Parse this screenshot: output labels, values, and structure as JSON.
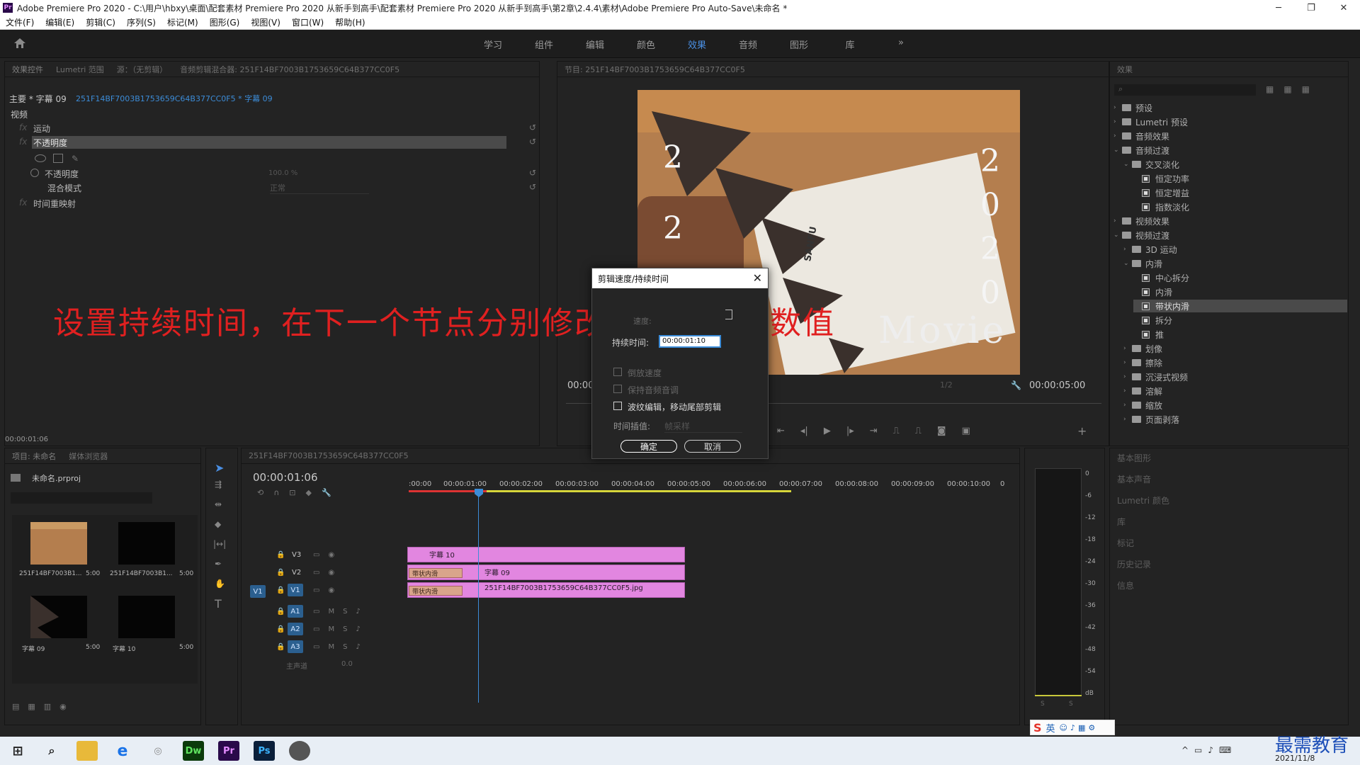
{
  "window": {
    "title": "Adobe Premiere Pro 2020 - C:\\用户\\hbxy\\桌面\\配套素材 Premiere Pro 2020 从新手到高手\\配套素材 Premiere Pro 2020 从新手到高手\\第2章\\2.4.4\\素材\\Adobe Premiere Pro Auto-Save\\未命名 *",
    "minimize": "─",
    "restore": "❐",
    "close": "✕"
  },
  "menu": [
    "文件(F)",
    "编辑(E)",
    "剪辑(C)",
    "序列(S)",
    "标记(M)",
    "图形(G)",
    "视图(V)",
    "窗口(W)",
    "帮助(H)"
  ],
  "workspaces": {
    "tabs": [
      "学习",
      "组件",
      "编辑",
      "颜色",
      "效果",
      "音频",
      "图形",
      "库"
    ],
    "active": "效果",
    "more": "»"
  },
  "effect_controls": {
    "tabs": [
      "效果控件",
      "Lumetri 范围",
      "源：（无剪辑）",
      "音频剪辑混合器: 251F14BF7003B1753659C64B377CC0F5"
    ],
    "master": "主要 * 字幕 09",
    "clip": "251F14BF7003B1753659C64B377CC0F5 * 字幕 09",
    "section": "视频",
    "motion": "运动",
    "opacity": "不透明度",
    "opacity_param": "不透明度",
    "opacity_value": "100.0 %",
    "blend_label": "混合模式",
    "blend_value": "正常",
    "time_remap": "时间重映射",
    "timecode": "00:00:01:06",
    "fx_glyph": "fx"
  },
  "program_monitor": {
    "title": "节目: 251F14BF7003B1753659C64B377CC0F5",
    "timecode_left": "00:00",
    "timecode_right": "00:00:05:00",
    "fraction": "1/2",
    "overlay_digits_left": "2",
    "overlay_digits_left2": "2",
    "overlay_digits_right": [
      "2",
      "0",
      "2",
      "0"
    ],
    "overlay_title": "Movie",
    "box_text": "SANFU"
  },
  "effects_panel": {
    "title": "效果",
    "items": [
      {
        "label": "预设",
        "level": 0,
        "kind": "folder",
        "open": false
      },
      {
        "label": "Lumetri 预设",
        "level": 0,
        "kind": "folder",
        "open": false
      },
      {
        "label": "音频效果",
        "level": 0,
        "kind": "folder",
        "open": false
      },
      {
        "label": "音频过渡",
        "level": 0,
        "kind": "folder",
        "open": true
      },
      {
        "label": "交叉淡化",
        "level": 1,
        "kind": "folder",
        "open": true
      },
      {
        "label": "恒定功率",
        "level": 2,
        "kind": "fx"
      },
      {
        "label": "恒定增益",
        "level": 2,
        "kind": "fx"
      },
      {
        "label": "指数淡化",
        "level": 2,
        "kind": "fx"
      },
      {
        "label": "视频效果",
        "level": 0,
        "kind": "folder",
        "open": false
      },
      {
        "label": "视频过渡",
        "level": 0,
        "kind": "folder",
        "open": true
      },
      {
        "label": "3D 运动",
        "level": 1,
        "kind": "folder",
        "open": false
      },
      {
        "label": "内滑",
        "level": 1,
        "kind": "folder",
        "open": true
      },
      {
        "label": "中心拆分",
        "level": 2,
        "kind": "fx"
      },
      {
        "label": "内滑",
        "level": 2,
        "kind": "fx"
      },
      {
        "label": "带状内滑",
        "level": 2,
        "kind": "fx",
        "selected": true
      },
      {
        "label": "拆分",
        "level": 2,
        "kind": "fx"
      },
      {
        "label": "推",
        "level": 2,
        "kind": "fx"
      },
      {
        "label": "划像",
        "level": 1,
        "kind": "folder",
        "open": false
      },
      {
        "label": "擦除",
        "level": 1,
        "kind": "folder",
        "open": false
      },
      {
        "label": "沉浸式视频",
        "level": 1,
        "kind": "folder",
        "open": false
      },
      {
        "label": "溶解",
        "level": 1,
        "kind": "folder",
        "open": false
      },
      {
        "label": "缩放",
        "level": 1,
        "kind": "folder",
        "open": false
      },
      {
        "label": "页面剥落",
        "level": 1,
        "kind": "folder",
        "open": false
      }
    ]
  },
  "side_panels": [
    "基本图形",
    "基本声音",
    "Lumetri 颜色",
    "库",
    "标记",
    "历史记录",
    "信息"
  ],
  "project": {
    "tabs": [
      "项目: 未命名",
      "媒体浏览器"
    ],
    "file": "未命名.prproj",
    "items": [
      {
        "name": "251F14BF7003B1...",
        "dur": "5:00",
        "kind": "photo"
      },
      {
        "name": "251F14BF7003B1...",
        "dur": "5:00",
        "kind": "dark"
      },
      {
        "name": "字幕 09",
        "dur": "5:00",
        "kind": "tri"
      },
      {
        "name": "字幕 10",
        "dur": "5:00",
        "kind": "dark"
      }
    ]
  },
  "timeline": {
    "tab": "251F14BF7003B1753659C64B377CC0F5",
    "timecode": "00:00:01:06",
    "ruler": [
      ":00:00",
      "00:00:01:00",
      "00:00:02:00",
      "00:00:03:00",
      "00:00:04:00",
      "00:00:05:00",
      "00:00:06:00",
      "00:00:07:00",
      "00:00:08:00",
      "00:00:09:00",
      "00:00:10:00",
      "0"
    ],
    "tracks": [
      "V3",
      "V2",
      "V1",
      "A1",
      "A2",
      "A3"
    ],
    "source_v1": "V1",
    "master": "主声道",
    "master_val": "0.0",
    "clips": {
      "v3": "字幕 10",
      "v2": "字幕 09",
      "v1": "251F14BF7003B1753659C64B377CC0F5.jpg",
      "trans_v2": "带状内滑",
      "trans_v1": "带状内滑"
    },
    "meter_labels": [
      "0",
      "-6",
      "-12",
      "-18",
      "-24",
      "-30",
      "-36",
      "-42",
      "-48",
      "-54",
      "dB"
    ],
    "meter_buttons": [
      "S",
      "S"
    ]
  },
  "dialog": {
    "title": "剪辑速度/持续时间",
    "speed_label": "速度:",
    "duration_label": "持续时间:",
    "duration_value": "00:00:01:10",
    "reverse": "倒放速度",
    "keep_pitch": "保持音频音调",
    "ripple": "波纹编辑，移动尾部剪辑",
    "interp_label": "时间插值:",
    "interp_value": "帧采样",
    "ok": "确定",
    "cancel": "取消",
    "close": "✕"
  },
  "caption": "设置持续时间，在下一个节点分别修改不透明度跟数值",
  "ime": "英",
  "brand": "最需教育",
  "date": "2021/11/8",
  "colors": {
    "accent": "#4a8fe3",
    "clip": "#e286e0",
    "caption": "#e02020",
    "playhead": "#3c8cd8"
  }
}
